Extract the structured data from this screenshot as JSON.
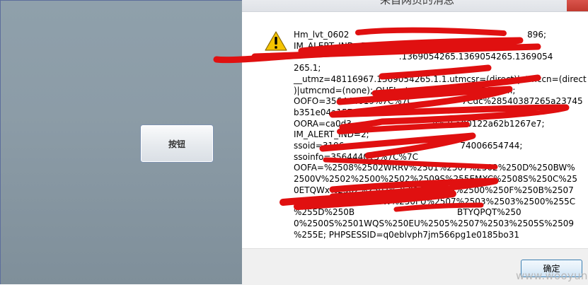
{
  "page": {
    "button_label": "按钮"
  },
  "dialog": {
    "title": "来自网页的消息",
    "icon": "warning-icon",
    "message_lines": [
      "Hm_lvt_0602                                                                  896;",
      "IM_ALERT_IND=5; 115_lang=zh;",
      "                                       .1369054265.1369054265.1369054",
      "265.1;",
      "__utmz=48116967.1369054265.1.1.utmcsr=(direct)|utmccn=(direct",
      ")|utmcmd=(none); OUFL=tmpmail126%40126.com;",
      "OOFO=356444019%7C%7C                  7Cdc%28540387265a23745",
      "b351e04a157;",
      "OORA=ca0d3                              lc675a00122a62b1267e7;",
      "IM_ALERT_IND=2;",
      "ssoid=3196                                           74006654744;",
      "ssoinfo=356444015%7C%7C",
      "OOFA=%2508%2502WRRV%2501%2507%2502%250D%250BW%",
      "2500V%2502%2500%2502%2509S%255EMXC%2508S%250C%25",
      "0ETQWx%2502%2507%2501O%2505%2500%250F%250B%2507",
      "%2504%2500%2508W%250FU%2507%2503%2503%2500%255C",
      "%255D%250B                                      BTYQPQT%250",
      "0%2500S%2501WQS%250EU%2505%2507%2503%2505S%2509",
      "%255E; PHPSESSID=q0eblvph7jm566pg1e0185bo31"
    ],
    "ok_button_label": "确定"
  },
  "watermark": "www.wooyun.org",
  "colors": {
    "redaction": "#e01010",
    "ok_border": "#3c7fb1"
  }
}
